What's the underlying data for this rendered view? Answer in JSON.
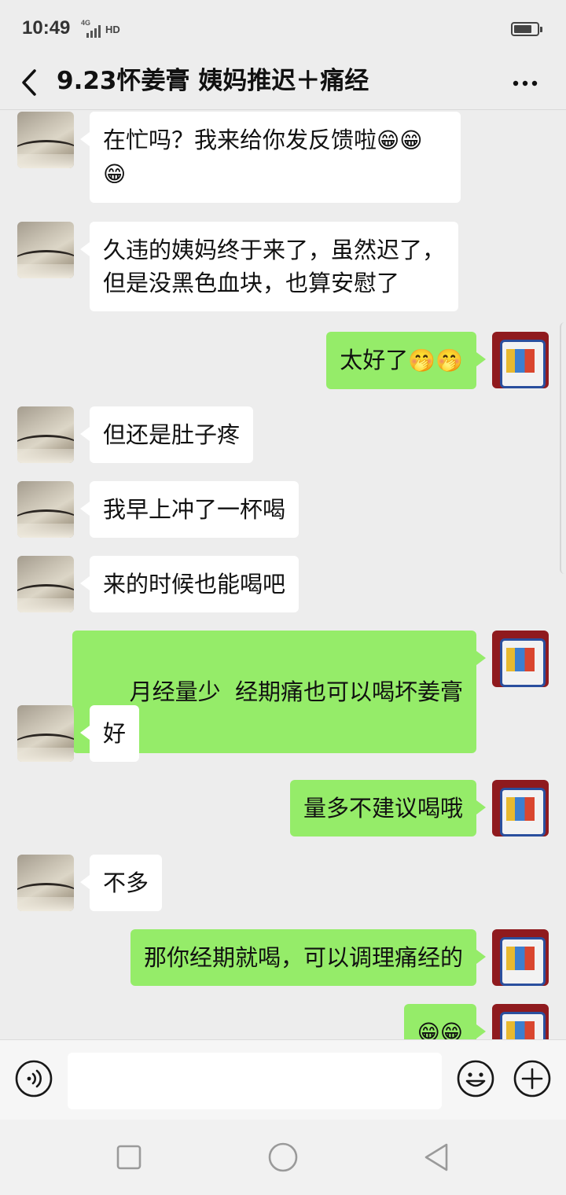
{
  "status_bar": {
    "time": "10:49",
    "network": "4G",
    "hd": "HD"
  },
  "header": {
    "title": "9.23怀姜膏 姨妈推迟＋痛经",
    "back_icon": "chevron-left-icon",
    "more_icon": "more-dots-icon"
  },
  "messages": [
    {
      "side": "in",
      "parts": [
        "在忙吗？我来给你发反馈啦",
        "😁",
        "😁",
        "😁"
      ]
    },
    {
      "side": "in",
      "lines": [
        "久违的姨妈终于来了，虽然迟了，",
        "但是没黑色血块，也算安慰了"
      ]
    },
    {
      "side": "out",
      "parts": [
        "太好了",
        "🤭",
        "🤭"
      ]
    },
    {
      "side": "in",
      "text": "但还是肚子疼"
    },
    {
      "side": "in",
      "text": "我早上冲了一杯喝"
    },
    {
      "side": "in",
      "text": "来的时候也能喝吧"
    },
    {
      "side": "out",
      "text": "月经量少  经期痛也可以喝坏姜膏"
    },
    {
      "side": "in",
      "text": "好"
    },
    {
      "side": "out",
      "text": "量多不建议喝哦"
    },
    {
      "side": "in",
      "text": "不多"
    },
    {
      "side": "out",
      "text": "那你经期就喝，可以调理痛经的"
    },
    {
      "side": "out",
      "parts": [
        "😁",
        "😁"
      ]
    }
  ],
  "input": {
    "value": "",
    "voice_icon": "voice-icon",
    "emoji_icon": "emoji-icon",
    "plus_icon": "plus-icon"
  },
  "nav": {
    "recents_icon": "square-icon",
    "home_icon": "circle-icon",
    "back_icon": "triangle-back-icon"
  },
  "colors": {
    "background": "#ededed",
    "incoming_bubble": "#ffffff",
    "outgoing_bubble": "#95ec69"
  }
}
